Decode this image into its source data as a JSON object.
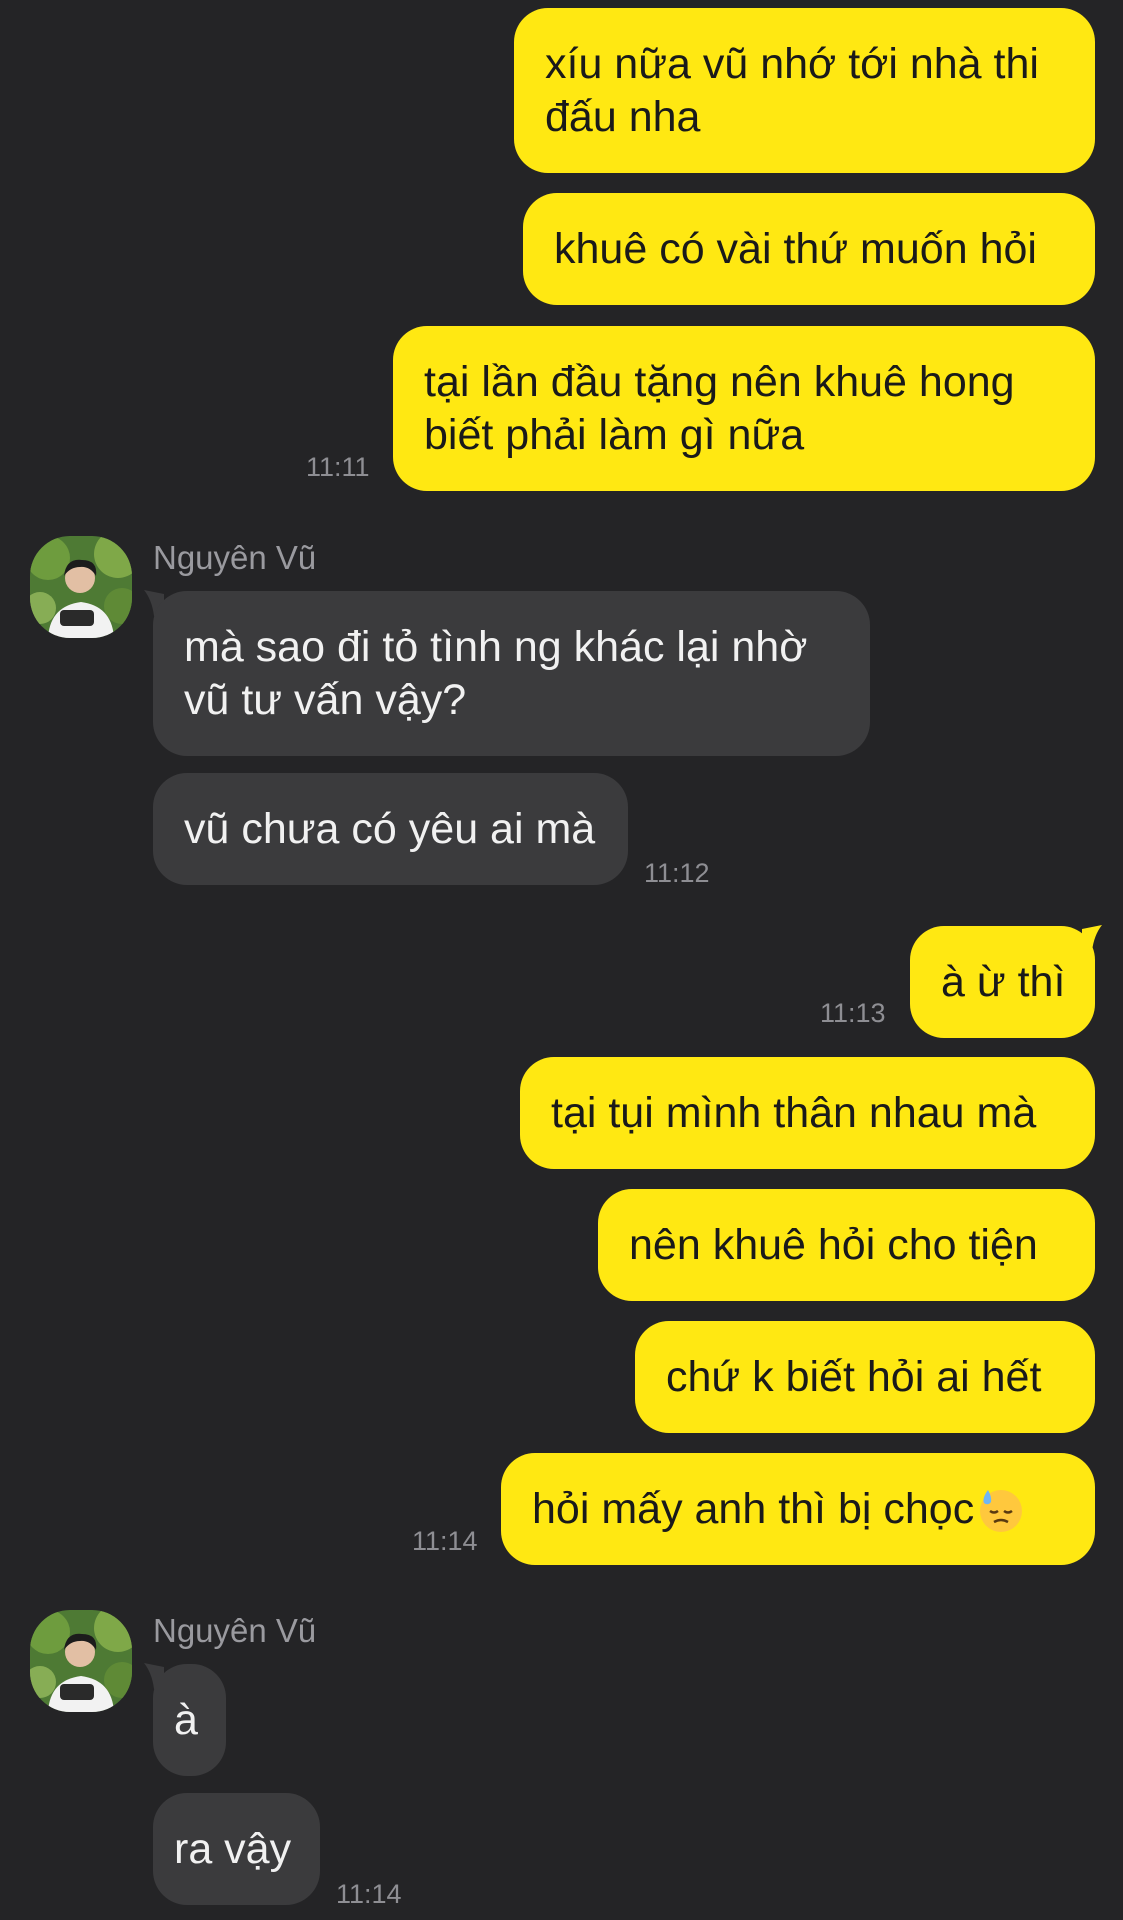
{
  "contact": {
    "name": "Nguyên Vũ",
    "avatar_icon": "person-avatar-icon"
  },
  "messages": [
    {
      "sender": "me",
      "text": "xíu nữa vũ nhớ tới nhà thi đấu nha"
    },
    {
      "sender": "me",
      "text": "khuê có vài thứ muốn hỏi"
    },
    {
      "sender": "me",
      "text": "tại lần đầu tặng nên khuê hong biết phải làm gì nữa",
      "time": "11:11"
    },
    {
      "sender": "them",
      "name": "Nguyên Vũ",
      "text": "mà sao đi tỏ tình ng khác lại nhờ vũ tư vấn vậy?"
    },
    {
      "sender": "them",
      "text": "vũ chưa có yêu ai mà",
      "time": "11:12"
    },
    {
      "sender": "me",
      "text": "à ừ thì",
      "time": "11:13"
    },
    {
      "sender": "me",
      "text": "tại tụi mình thân nhau mà"
    },
    {
      "sender": "me",
      "text": "nên khuê hỏi cho tiện"
    },
    {
      "sender": "me",
      "text": "chứ k biết hỏi ai hết"
    },
    {
      "sender": "me",
      "text": "hỏi mấy anh thì bị chọc",
      "emoji": "sweat-downcast-face-emoji",
      "time": "11:14"
    },
    {
      "sender": "them",
      "name": "Nguyên Vũ",
      "text": "à"
    },
    {
      "sender": "them",
      "text": "ra vậy",
      "time": "11:14"
    }
  ],
  "colors": {
    "background": "#242426",
    "my_bubble": "#FFE812",
    "their_bubble": "#3B3B3D",
    "timestamp": "#8E8E93"
  }
}
